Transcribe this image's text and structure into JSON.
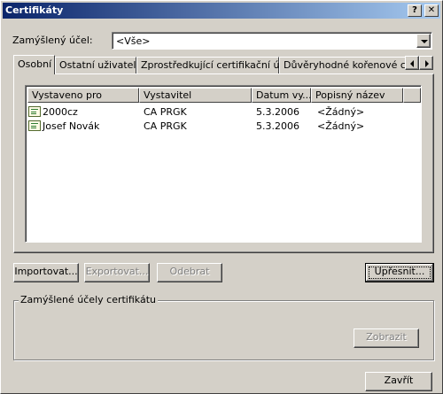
{
  "window": {
    "title": "Certifikáty",
    "help_button": "?",
    "close_button": "✕"
  },
  "purpose": {
    "label": "Zamýšlený účel:",
    "selected": "<Vše>"
  },
  "tabs": [
    {
      "label": "Osobní",
      "active": true
    },
    {
      "label": "Ostatní uživatelé",
      "active": false
    },
    {
      "label": "Zprostředkující certifikační úřady",
      "active": false
    },
    {
      "label": "Důvěryhodné kořenové certifikační úřady",
      "active": false
    }
  ],
  "list": {
    "columns": [
      "Vystaveno pro",
      "Vystavitel",
      "Datum vy...",
      "Popisný název"
    ],
    "rows": [
      {
        "icon": "certificate-icon",
        "issued_to": "2000cz",
        "issuer": "CA PRGK",
        "date": "5.3.2006",
        "friendly_name": "<Žádný>"
      },
      {
        "icon": "certificate-icon",
        "issued_to": "Josef Novák",
        "issuer": "CA PRGK",
        "date": "5.3.2006",
        "friendly_name": "<Žádný>"
      }
    ]
  },
  "buttons": {
    "import": "Importovat...",
    "export": "Exportovat...",
    "remove": "Odebrat",
    "advanced": "Upřesnit...",
    "view": "Zobrazit",
    "close": "Zavřít"
  },
  "group": {
    "label": "Zamýšlené účely certifikátu"
  }
}
